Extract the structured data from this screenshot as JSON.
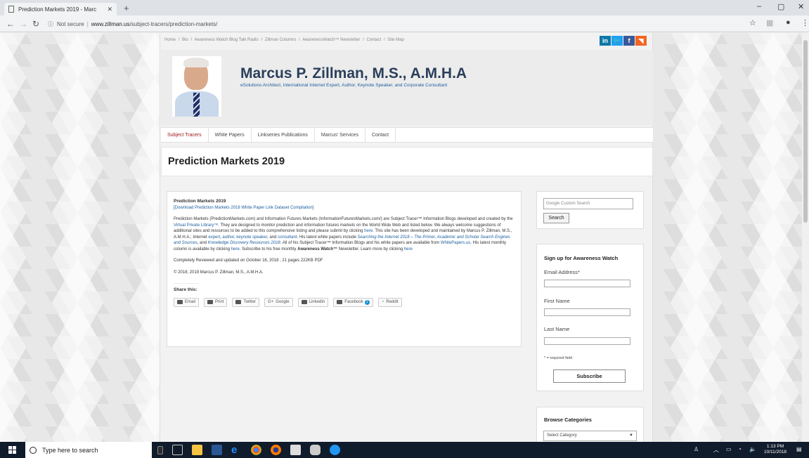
{
  "browser": {
    "tab_title": "Prediction Markets 2019 - Marc",
    "new_tab": "+",
    "security_label": "Not secure",
    "url_host": "www.zillman.us",
    "url_path": "/subject-tracers/prediction-markets/",
    "window_min": "–",
    "window_max": "▢",
    "window_close": "✕"
  },
  "site": {
    "top_links": [
      "Home",
      "/",
      "Bio",
      "/",
      "Awareness Watch Blog Talk Radio",
      "/",
      "Zillman Columns",
      "/",
      "AwarenessWatch™ Newsletter",
      "/",
      "Contact",
      "/",
      "Site Map"
    ],
    "social": [
      "in",
      "t",
      "f",
      "rss"
    ],
    "title": "Marcus P. Zillman, M.S., A.M.H.A",
    "tagline": "eSolutions Architect, International Internet Expert, Author, Keynote Speaker, and Corporate Consultant",
    "nav": [
      "Subject Tracers",
      "White Papers",
      "Linkseries Publications",
      "Marcus' Services",
      "Contact"
    ]
  },
  "page": {
    "heading": "Prediction Markets 2019",
    "article": {
      "title": "Prediction Markets 2019",
      "download_link": "[Download Prediction Markets 2018 White Paper Link Dataset Compilation]",
      "body_a": "Prediction Markets (PredictionMarkets.com) and Information Futures Markets (InformationFuturesMarkets.com/) are  Subject Tracer™ Information Blogs developed and created by the ",
      "vpl": "Virtual Private Library™",
      "body_b": ". They are designed to monitor prediction and information futures markets on the World Wide Web and listed below. We always welcome suggestions of additional sites and resources to be added to this comprehensive listing and please submit by clicking ",
      "here1": "here",
      "body_c": ". This site has been developed and maintained by Marcus P. Zillman, M.S., A.M.H.A.; Internet ",
      "expert": "expert",
      "author": "author",
      "keynote": "keynote speaker",
      "and_word": ", and ",
      "consultant": "consultant",
      "body_d": ". His latest white papers include ",
      "wp1": "Searching the Internet 2018 – The Primer, Academic and Scholar Search Engines and Sources",
      "wp2": "Knowledge Discovery Resources 2018",
      "body_e": ". All of his Subject Tracer™ Information Blogs and his white papers are available from ",
      "whitepapers": "WhitePapers.us",
      "body_f": ".  His latest monthly column is available by clicking ",
      "here2": "here",
      "body_g": ". Subscribe to his free monthly ",
      "aw": "Awareness Watch™",
      "body_h": " Newsletter. Learn more by clicking ",
      "here3": "here",
      "reviewed": "Completely Reviewed and updated on October 16, 2018 ; 21 pages 222KB PDF",
      "copyright": "© 2018, 2019 Marcus P. Zillman, M.S., A.M.H.A.",
      "share_label": "Share this:",
      "share_buttons": [
        "Email",
        "Print",
        "Twitter",
        "Google",
        "LinkedIn",
        "Facebook",
        "Reddit"
      ],
      "facebook_count": "1"
    }
  },
  "sidebar": {
    "search_placeholder": "Google  Custom Search",
    "search_button": "Search",
    "signup_title": "Sign up for Awareness Watch",
    "email_label": "Email Address*",
    "first_name_label": "First Name",
    "last_name_label": "Last Name",
    "required_note": "* = required field",
    "subscribe_button": "Subscribe",
    "browse_title": "Browse Categories",
    "category_select": "Select Category"
  },
  "taskbar": {
    "search_placeholder": "Type here to search",
    "time": "1:13 PM",
    "date": "10/11/2018"
  },
  "colors": {
    "link": "#1a5e9e",
    "nav_active": "#a0181e",
    "taskbar": "#101b2c"
  }
}
